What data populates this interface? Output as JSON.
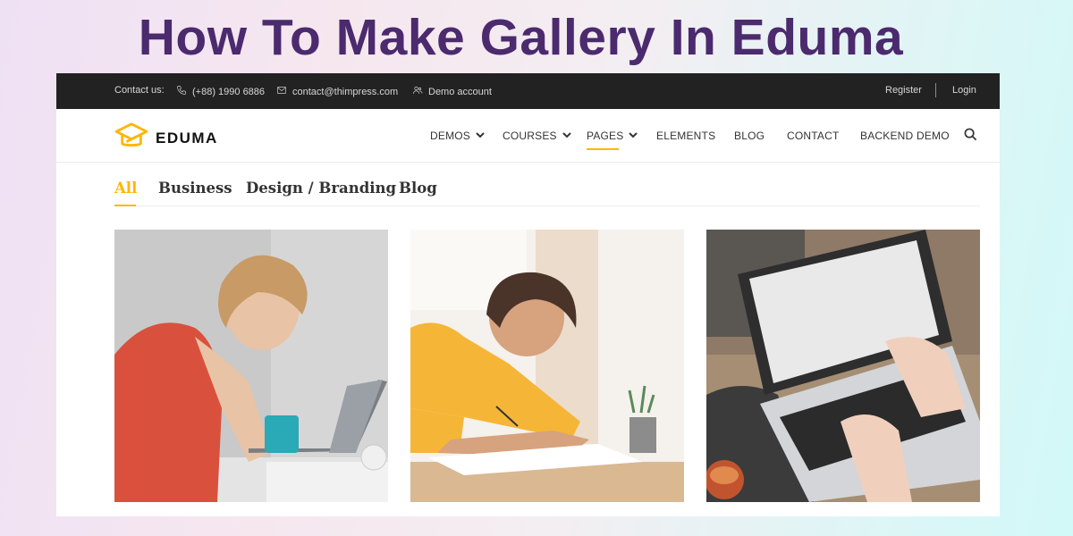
{
  "headline": "How To Make Gallery In Eduma",
  "topbar": {
    "contact_label": "Contact us:",
    "phone": "(+88) 1990 6886",
    "email": "contact@thimpress.com",
    "demo_account": "Demo account",
    "register": "Register",
    "login": "Login"
  },
  "brand": {
    "name": "EDUMA",
    "accent": "#ffb606"
  },
  "nav": {
    "items": [
      "DEMOS",
      "COURSES",
      "PAGES",
      "ELEMENTS",
      "BLOG",
      "CONTACT",
      "BACKEND DEMO"
    ],
    "active": "PAGES"
  },
  "filters": {
    "items": [
      "All",
      "Business",
      "Design / Branding",
      "Blog"
    ],
    "active": "All"
  },
  "icons": {
    "phone": "phone-icon",
    "email": "envelope-icon",
    "demo": "users-icon",
    "search": "search-icon",
    "chevron": "chevron-down-icon",
    "logo": "graduation-cap-icon"
  },
  "colors": {
    "title": "#4b2a6e",
    "topbar_bg": "#222222",
    "accent": "#ffb606"
  },
  "gallery": [
    {
      "alt": "Stressed woman in red shirt at laptop"
    },
    {
      "alt": "Smiling girl in yellow shirt writing"
    },
    {
      "alt": "Hands typing on laptop keyboard"
    }
  ]
}
